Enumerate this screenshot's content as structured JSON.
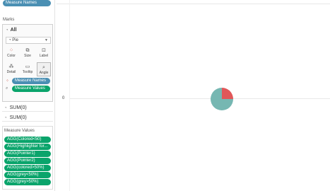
{
  "columns_pill": "Measure Names",
  "marks": {
    "section_label": "Marks",
    "all_label": "All",
    "mark_type": "Pie",
    "buttons": {
      "color": "Color",
      "size": "Size",
      "label": "Label",
      "detail": "Detail",
      "tooltip": "Tooltip",
      "angle": "Angle"
    },
    "fields": [
      "Measure Names",
      "Measure Values"
    ]
  },
  "shelves": [
    "SUM(0)",
    "SUM(0)"
  ],
  "measure_values": {
    "title": "Measure Values",
    "items": [
      "AGG(Colored<50)",
      "AGG(Highlighter for...",
      "AGG(Pointer1)",
      "AGG(Pointer2)",
      "AGG(colored>50%)",
      "AGG(grey<50%)",
      "AGG(grey>50%)"
    ]
  },
  "view": {
    "axis_zero": "0",
    "pie_colors": [
      "#e15759",
      "#76b7b2"
    ],
    "pie_fractions": [
      0.25,
      0.75
    ]
  }
}
